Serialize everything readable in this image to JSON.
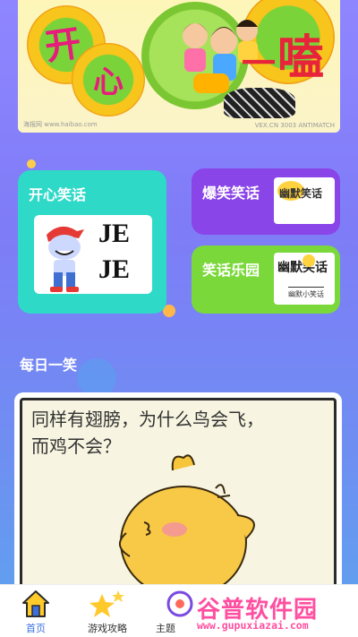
{
  "banner": {
    "title_chars": [
      "开",
      "心",
      "一",
      "嗑"
    ],
    "watermark_left": "海报网 www.haibao.com",
    "watermark_right": "VEX.CN 3003 ANTIMATCH"
  },
  "cards": {
    "happy_jokes": {
      "label": "开心笑话",
      "image_text": [
        "JE",
        "JE"
      ]
    },
    "funny_jokes": {
      "label": "爆笑笑话",
      "image_text": "幽默笑话"
    },
    "joke_park": {
      "label": "笑话乐园",
      "image_text": "幽默笑话",
      "image_subtext": "幽默小笑话"
    }
  },
  "daily": {
    "title": "每日一笑",
    "comic_text_line1": "同样有翅膀，为什么鸟会飞，",
    "comic_text_line2": "而鸡不会？"
  },
  "tabs": [
    {
      "label": "首页",
      "icon": "home-icon",
      "active": true
    },
    {
      "label": "游戏攻略",
      "icon": "stars-icon",
      "active": false
    },
    {
      "label": "主题",
      "icon": "theme-icon",
      "active": false
    }
  ],
  "watermark": {
    "name": "谷普软件园",
    "url": "www.gupuxiazai.com"
  },
  "colors": {
    "card_teal": "#2ed9c8",
    "card_purple": "#8a45e8",
    "card_green": "#7ad83a",
    "tab_active": "#3b6fe0",
    "watermark_pink": "#ff4fa0"
  }
}
